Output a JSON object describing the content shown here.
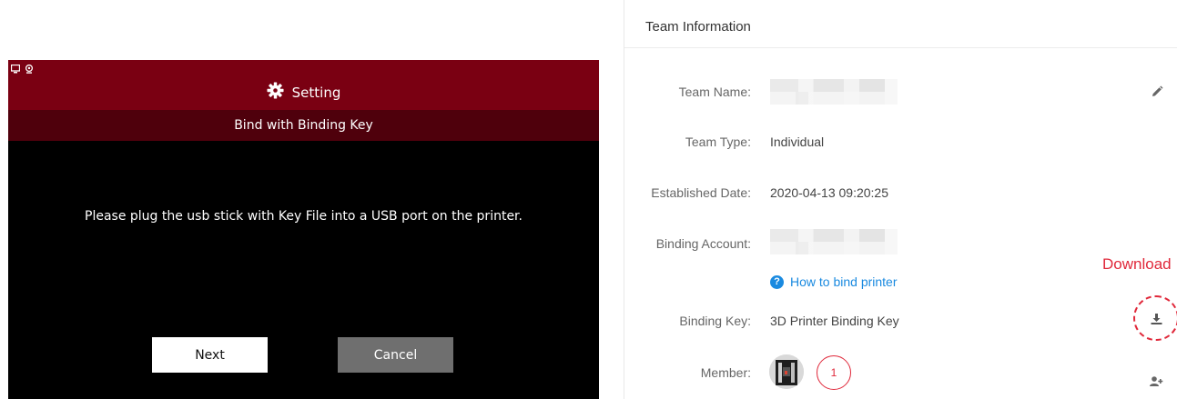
{
  "printer_screen": {
    "header_title": "Setting",
    "subtitle": "Bind with Binding Key",
    "message": "Please plug the usb stick with Key File into a USB port on the printer.",
    "next_label": "Next",
    "cancel_label": "Cancel",
    "icons": [
      "monitor-icon",
      "webcam-icon",
      "gear-icon"
    ]
  },
  "team_panel": {
    "title": "Team Information",
    "fields": {
      "team_name_label": "Team Name:",
      "team_type_label": "Team Type:",
      "team_type_value": "Individual",
      "established_label": "Established Date:",
      "established_value": "2020-04-13 09:20:25",
      "binding_account_label": "Binding Account:",
      "binding_key_label": "Binding Key:",
      "binding_key_value": "3D Printer Binding Key",
      "member_label": "Member:",
      "member_count": "1"
    },
    "help_link": "How to bind printer",
    "download_annotation": "Download",
    "icons": [
      "pencil-icon",
      "help-icon",
      "download-icon",
      "add-member-icon"
    ]
  },
  "colors": {
    "printer_header": "#7a0012",
    "printer_subbar": "#4f000c",
    "link_blue": "#1a8ae0",
    "accent_red": "#e0283a"
  }
}
